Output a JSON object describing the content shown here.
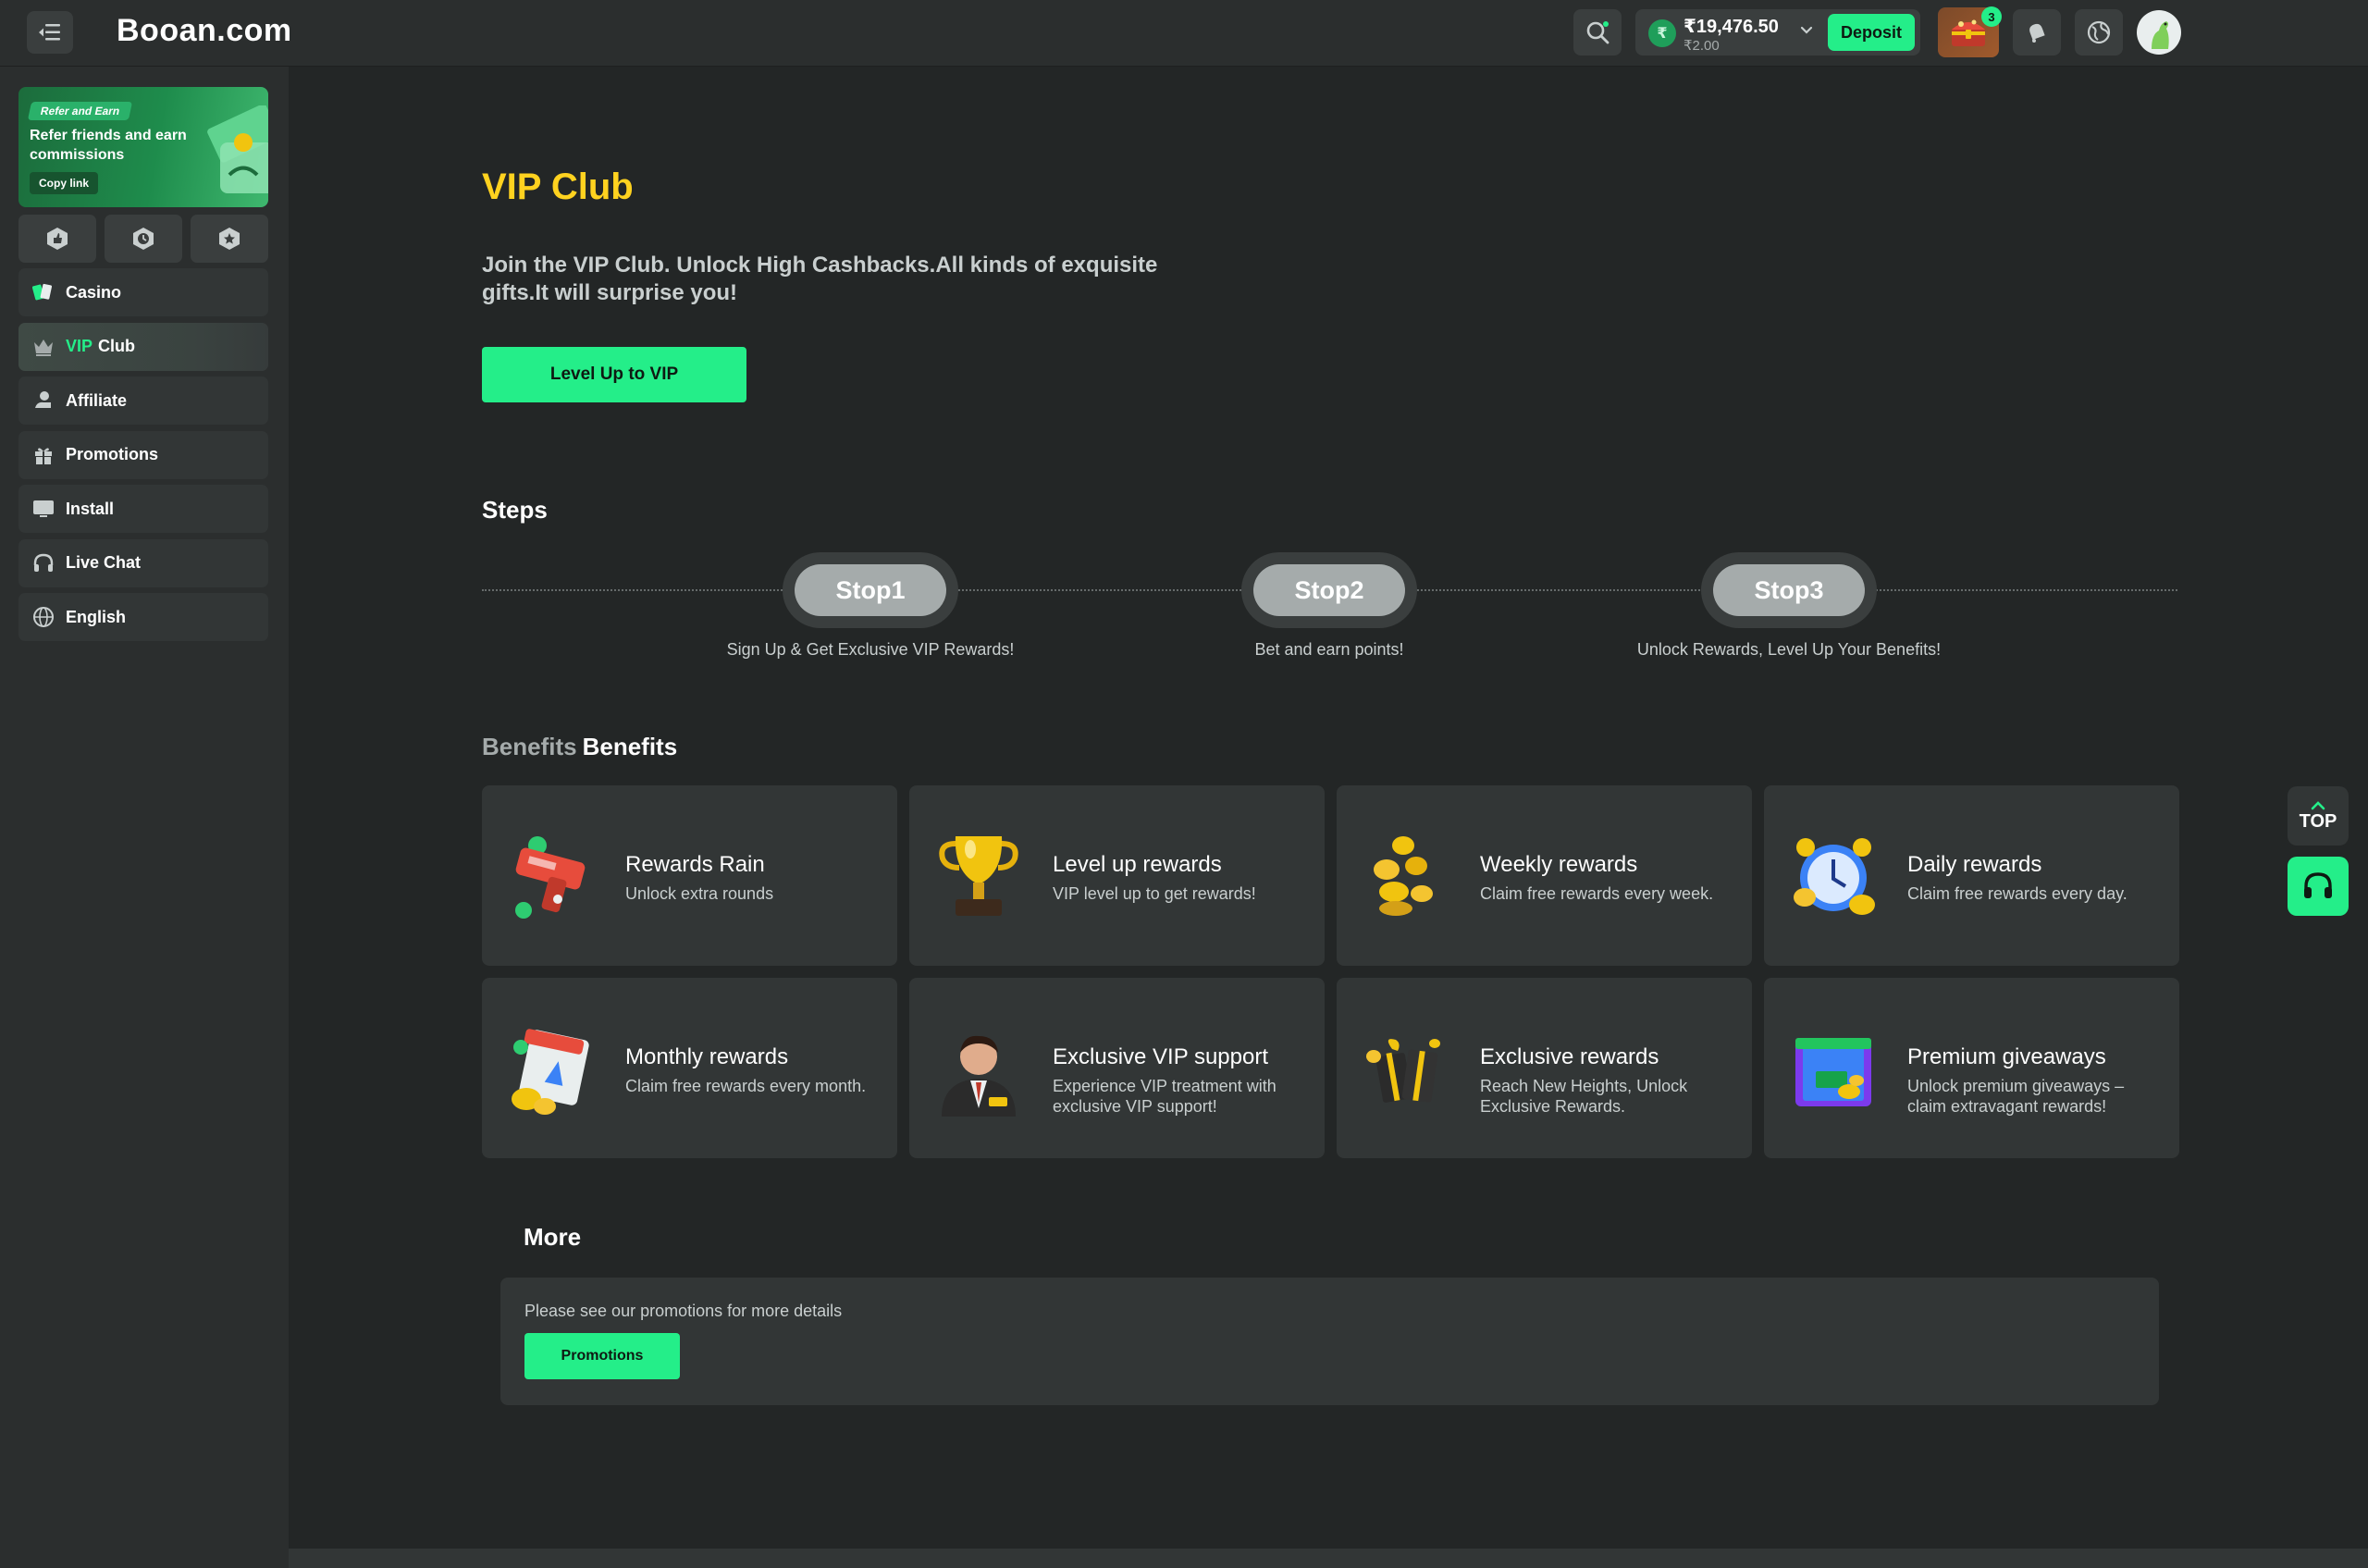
{
  "header": {
    "logo": "Booan.com",
    "balance_main": "₹19,476.50",
    "balance_sub": "₹2.00",
    "currency_symbol": "₹",
    "deposit_label": "Deposit",
    "chest_badge": "3",
    "icons": [
      "menu-icon",
      "search-icon",
      "chevron-down-icon",
      "treasure-chest-icon",
      "bell-icon",
      "globe-icon",
      "avatar"
    ]
  },
  "sidebar": {
    "refer": {
      "tag": "Refer and Earn",
      "title": "Refer friends and earn commissions",
      "copy_label": "Copy link"
    },
    "quick_icons": [
      "thumbs-up-icon",
      "clock-icon",
      "star-icon"
    ],
    "items": [
      {
        "label": "Casino",
        "icon": "casino-cards-icon"
      },
      {
        "label_prefix": "VIP",
        "label": "Club",
        "icon": "crown-icon"
      },
      {
        "label": "Affiliate",
        "icon": "affiliate-icon"
      },
      {
        "label": "Promotions",
        "icon": "gift-icon"
      },
      {
        "label": "Install",
        "icon": "monitor-icon"
      },
      {
        "label": "Live Chat",
        "icon": "headset-icon"
      },
      {
        "label": "English",
        "icon": "globe-icon"
      }
    ]
  },
  "main": {
    "title": "VIP Club",
    "intro": "Join the VIP Club. Unlock High Cashbacks.All kinds of exquisite gifts.It will surprise you!",
    "levelup_label": "Level Up to VIP",
    "steps_title": "Steps",
    "steps": [
      {
        "label": "Stop1",
        "desc": "Sign Up & Get Exclusive VIP Rewards!"
      },
      {
        "label": "Stop2",
        "desc": "Bet and earn points!"
      },
      {
        "label": "Stop3",
        "desc": "Unlock Rewards, Level Up Your Benefits!"
      }
    ],
    "benefits_title_muted": "Benefits",
    "benefits_title": "Benefits",
    "benefits": [
      {
        "title": "Rewards Rain",
        "desc": "Unlock extra rounds",
        "icon": "money-gun-icon"
      },
      {
        "title": "Level up rewards",
        "desc": "VIP level up to get rewards!",
        "icon": "trophy-icon"
      },
      {
        "title": "Weekly rewards",
        "desc": "Claim free rewards every week.",
        "icon": "coins-icon"
      },
      {
        "title": "Daily rewards",
        "desc": "Claim free rewards every day.",
        "icon": "alarm-clock-icon"
      },
      {
        "title": "Monthly rewards",
        "desc": "Claim free rewards every month.",
        "icon": "calendar-icon"
      },
      {
        "title": "Exclusive VIP support",
        "desc": "Experience VIP treatment with exclusive VIP support!",
        "icon": "vip-agent-icon"
      },
      {
        "title": "Exclusive rewards",
        "desc": "Reach New Heights, Unlock Exclusive Rewards.",
        "icon": "gift-box-icon"
      },
      {
        "title": "Premium giveaways",
        "desc": "Unlock premium giveaways – claim extravagant rewards!",
        "icon": "treasure-box-icon"
      }
    ],
    "more_title": "More",
    "more_text": "Please see our promotions for more details",
    "promotions_label": "Promotions"
  },
  "floating": {
    "top_label": "TOP",
    "icons": [
      "chevron-up-icon",
      "headset-icon"
    ]
  },
  "colors": {
    "accent": "#24ee89",
    "title_yellow": "#ffd21f",
    "background": "#232626",
    "panel": "#323636"
  }
}
